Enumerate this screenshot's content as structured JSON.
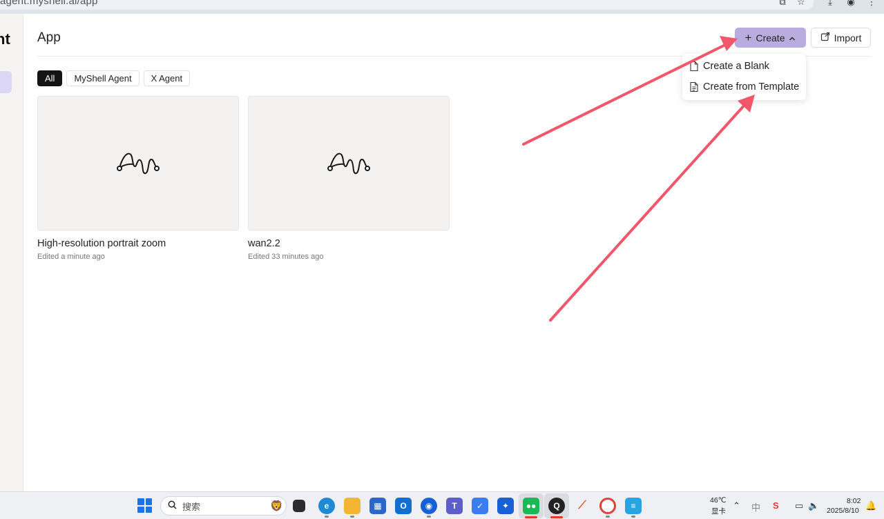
{
  "browser": {
    "url": "agent.myshell.ai/app",
    "icons": [
      "translate-icon",
      "star-icon",
      "download-icon",
      "profile-icon",
      "more-icon"
    ]
  },
  "sidebar": {
    "logo_fragment": "nt"
  },
  "header": {
    "title": "App",
    "create_label": "Create",
    "import_label": "Import"
  },
  "filters": [
    {
      "label": "All",
      "active": true
    },
    {
      "label": "MyShell Agent",
      "active": false
    },
    {
      "label": "X Agent",
      "active": false
    }
  ],
  "apps": [
    {
      "title": "High-resolution portrait zoom",
      "edited": "Edited a minute ago"
    },
    {
      "title": "wan2.2",
      "edited": "Edited 33 minutes ago"
    }
  ],
  "dropdown": {
    "items": [
      {
        "label": "Create a Blank",
        "icon": "blank-file-icon"
      },
      {
        "label": "Create from Template",
        "icon": "template-file-icon"
      }
    ]
  },
  "annotation": {
    "arrow_color": "#f2566a"
  },
  "taskbar": {
    "search_placeholder": "搜索",
    "temperature": "46℃",
    "temperature_label": "显卡",
    "time": "8:02",
    "date": "2025/8/10",
    "ime": "中"
  }
}
